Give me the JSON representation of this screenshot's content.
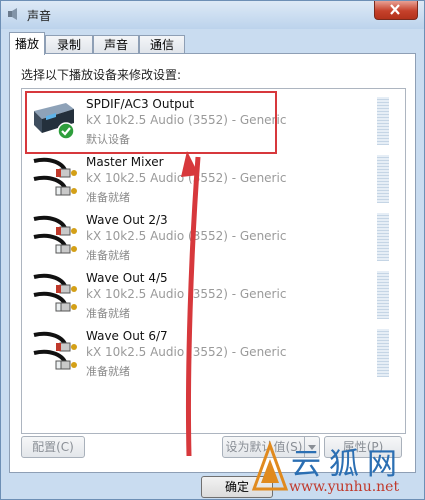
{
  "window": {
    "title": "声音"
  },
  "tabs": [
    {
      "label": "播放"
    },
    {
      "label": "录制"
    },
    {
      "label": "声音"
    },
    {
      "label": "通信"
    }
  ],
  "instruction": "选择以下播放设备来修改设置:",
  "devices": [
    {
      "name": "SPDIF/AC3 Output",
      "desc": "kX 10k2.5 Audio (3552) - Generic",
      "status": "默认设备",
      "icon": "digital-output-icon",
      "default": true
    },
    {
      "name": "Master Mixer",
      "desc": "kX 10k2.5 Audio (3552) - Generic",
      "status": "准备就绪",
      "icon": "rca-cable-icon"
    },
    {
      "name": "Wave Out 2/3",
      "desc": "kX 10k2.5 Audio (3552) - Generic",
      "status": "准备就绪",
      "icon": "rca-cable-icon"
    },
    {
      "name": "Wave Out 4/5",
      "desc": "kX 10k2.5 Audio (3552) - Generic",
      "status": "准备就绪",
      "icon": "rca-cable-icon"
    },
    {
      "name": "Wave Out 6/7",
      "desc": "kX 10k2.5 Audio (3552) - Generic",
      "status": "准备就绪",
      "icon": "rca-cable-icon"
    }
  ],
  "buttons": {
    "configure": "配置(C)",
    "set_default": "设为默认值(S)",
    "properties": "属性(P)",
    "ok": "确定"
  },
  "watermark": {
    "text": "云狐网",
    "url": "www.yunhu.net"
  },
  "colors": {
    "highlight": "#d7383c",
    "arrow": "#d7383c",
    "accent": "#2b6fb3"
  }
}
